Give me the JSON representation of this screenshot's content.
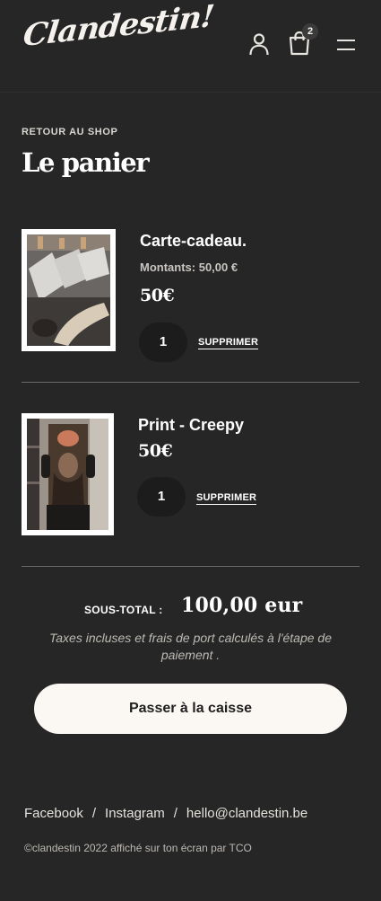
{
  "header": {
    "logo_text": "Clandestin!",
    "cart_count": "2",
    "icons": [
      "account-icon",
      "bag-icon",
      "menu-icon"
    ]
  },
  "page": {
    "back_label": "RETOUR AU SHOP",
    "title": "Le panier"
  },
  "cart": {
    "items": [
      {
        "name": "Carte-cadeau.",
        "variant": "Montants: 50,00 €",
        "price": "50€",
        "quantity": "1",
        "remove_label": "SUPPRIMER"
      },
      {
        "name": "Print - Creepy",
        "price": "50€",
        "quantity": "1",
        "remove_label": "SUPPRIMER"
      }
    ],
    "subtotal_label": "SOUS-TOTAL :",
    "subtotal_value": "100,00 eur",
    "tax_note": "Taxes incluses et frais de port calculés à l'étape de paiement .",
    "checkout_label": "Passer à la caisse"
  },
  "footer": {
    "links": [
      "Facebook",
      "Instagram",
      "hello@clandestin.be"
    ],
    "separator": "/",
    "copyright": "©clandestin 2022 affiché sur ton écran par TCO"
  },
  "colors": {
    "background": "#262626",
    "button_bg": "#fbf7f3",
    "qty_bg": "#1c1c1c"
  }
}
